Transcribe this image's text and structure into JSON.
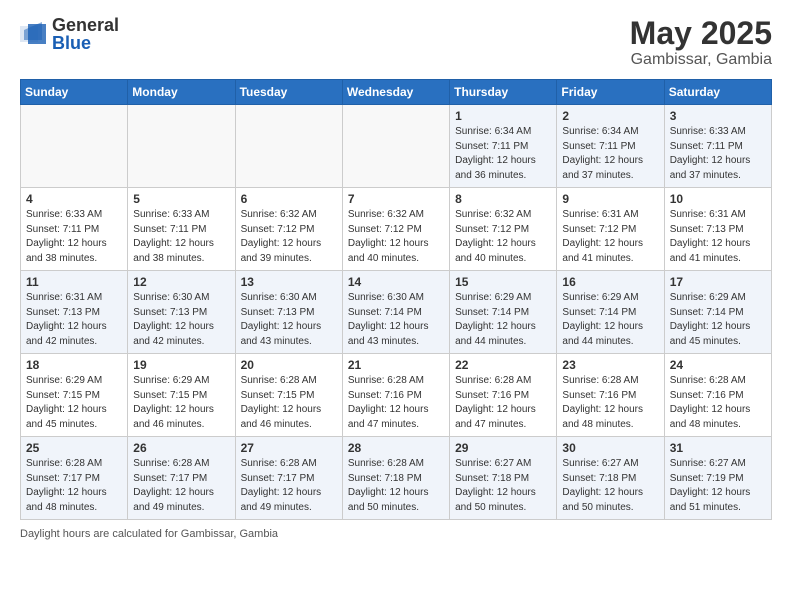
{
  "logo": {
    "general": "General",
    "blue": "Blue"
  },
  "title": {
    "month": "May 2025",
    "location": "Gambissar, Gambia"
  },
  "header_days": [
    "Sunday",
    "Monday",
    "Tuesday",
    "Wednesday",
    "Thursday",
    "Friday",
    "Saturday"
  ],
  "weeks": [
    {
      "row_style": "odd",
      "days": [
        {
          "num": "",
          "info": ""
        },
        {
          "num": "",
          "info": ""
        },
        {
          "num": "",
          "info": ""
        },
        {
          "num": "",
          "info": ""
        },
        {
          "num": "1",
          "info": "Sunrise: 6:34 AM\nSunset: 7:11 PM\nDaylight: 12 hours\nand 36 minutes."
        },
        {
          "num": "2",
          "info": "Sunrise: 6:34 AM\nSunset: 7:11 PM\nDaylight: 12 hours\nand 37 minutes."
        },
        {
          "num": "3",
          "info": "Sunrise: 6:33 AM\nSunset: 7:11 PM\nDaylight: 12 hours\nand 37 minutes."
        }
      ]
    },
    {
      "row_style": "even",
      "days": [
        {
          "num": "4",
          "info": "Sunrise: 6:33 AM\nSunset: 7:11 PM\nDaylight: 12 hours\nand 38 minutes."
        },
        {
          "num": "5",
          "info": "Sunrise: 6:33 AM\nSunset: 7:11 PM\nDaylight: 12 hours\nand 38 minutes."
        },
        {
          "num": "6",
          "info": "Sunrise: 6:32 AM\nSunset: 7:12 PM\nDaylight: 12 hours\nand 39 minutes."
        },
        {
          "num": "7",
          "info": "Sunrise: 6:32 AM\nSunset: 7:12 PM\nDaylight: 12 hours\nand 40 minutes."
        },
        {
          "num": "8",
          "info": "Sunrise: 6:32 AM\nSunset: 7:12 PM\nDaylight: 12 hours\nand 40 minutes."
        },
        {
          "num": "9",
          "info": "Sunrise: 6:31 AM\nSunset: 7:12 PM\nDaylight: 12 hours\nand 41 minutes."
        },
        {
          "num": "10",
          "info": "Sunrise: 6:31 AM\nSunset: 7:13 PM\nDaylight: 12 hours\nand 41 minutes."
        }
      ]
    },
    {
      "row_style": "odd",
      "days": [
        {
          "num": "11",
          "info": "Sunrise: 6:31 AM\nSunset: 7:13 PM\nDaylight: 12 hours\nand 42 minutes."
        },
        {
          "num": "12",
          "info": "Sunrise: 6:30 AM\nSunset: 7:13 PM\nDaylight: 12 hours\nand 42 minutes."
        },
        {
          "num": "13",
          "info": "Sunrise: 6:30 AM\nSunset: 7:13 PM\nDaylight: 12 hours\nand 43 minutes."
        },
        {
          "num": "14",
          "info": "Sunrise: 6:30 AM\nSunset: 7:14 PM\nDaylight: 12 hours\nand 43 minutes."
        },
        {
          "num": "15",
          "info": "Sunrise: 6:29 AM\nSunset: 7:14 PM\nDaylight: 12 hours\nand 44 minutes."
        },
        {
          "num": "16",
          "info": "Sunrise: 6:29 AM\nSunset: 7:14 PM\nDaylight: 12 hours\nand 44 minutes."
        },
        {
          "num": "17",
          "info": "Sunrise: 6:29 AM\nSunset: 7:14 PM\nDaylight: 12 hours\nand 45 minutes."
        }
      ]
    },
    {
      "row_style": "even",
      "days": [
        {
          "num": "18",
          "info": "Sunrise: 6:29 AM\nSunset: 7:15 PM\nDaylight: 12 hours\nand 45 minutes."
        },
        {
          "num": "19",
          "info": "Sunrise: 6:29 AM\nSunset: 7:15 PM\nDaylight: 12 hours\nand 46 minutes."
        },
        {
          "num": "20",
          "info": "Sunrise: 6:28 AM\nSunset: 7:15 PM\nDaylight: 12 hours\nand 46 minutes."
        },
        {
          "num": "21",
          "info": "Sunrise: 6:28 AM\nSunset: 7:16 PM\nDaylight: 12 hours\nand 47 minutes."
        },
        {
          "num": "22",
          "info": "Sunrise: 6:28 AM\nSunset: 7:16 PM\nDaylight: 12 hours\nand 47 minutes."
        },
        {
          "num": "23",
          "info": "Sunrise: 6:28 AM\nSunset: 7:16 PM\nDaylight: 12 hours\nand 48 minutes."
        },
        {
          "num": "24",
          "info": "Sunrise: 6:28 AM\nSunset: 7:16 PM\nDaylight: 12 hours\nand 48 minutes."
        }
      ]
    },
    {
      "row_style": "odd",
      "days": [
        {
          "num": "25",
          "info": "Sunrise: 6:28 AM\nSunset: 7:17 PM\nDaylight: 12 hours\nand 48 minutes."
        },
        {
          "num": "26",
          "info": "Sunrise: 6:28 AM\nSunset: 7:17 PM\nDaylight: 12 hours\nand 49 minutes."
        },
        {
          "num": "27",
          "info": "Sunrise: 6:28 AM\nSunset: 7:17 PM\nDaylight: 12 hours\nand 49 minutes."
        },
        {
          "num": "28",
          "info": "Sunrise: 6:28 AM\nSunset: 7:18 PM\nDaylight: 12 hours\nand 50 minutes."
        },
        {
          "num": "29",
          "info": "Sunrise: 6:27 AM\nSunset: 7:18 PM\nDaylight: 12 hours\nand 50 minutes."
        },
        {
          "num": "30",
          "info": "Sunrise: 6:27 AM\nSunset: 7:18 PM\nDaylight: 12 hours\nand 50 minutes."
        },
        {
          "num": "31",
          "info": "Sunrise: 6:27 AM\nSunset: 7:19 PM\nDaylight: 12 hours\nand 51 minutes."
        }
      ]
    }
  ],
  "footer": {
    "note": "Daylight hours are calculated for Gambissar, Gambia"
  }
}
